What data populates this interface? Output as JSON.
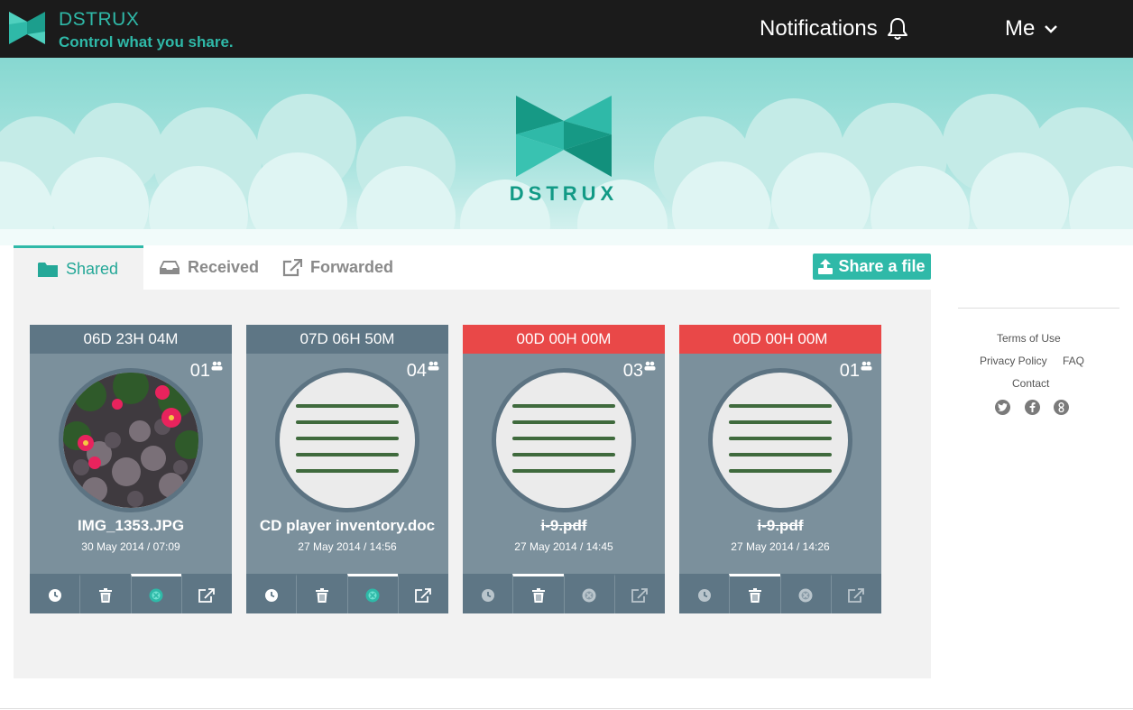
{
  "header": {
    "brand_name": "DSTRUX",
    "tagline": "Control what you share.",
    "notifications_label": "Notifications",
    "me_label": "Me"
  },
  "hero": {
    "wordmark": "DSTRUX"
  },
  "tabs": [
    {
      "label": "Shared",
      "icon": "folder-icon",
      "active": true
    },
    {
      "label": "Received",
      "icon": "inbox-icon"
    },
    {
      "label": "Forwarded",
      "icon": "external-link-icon"
    }
  ],
  "share_button": {
    "label": "Share a file",
    "icon": "upload-icon"
  },
  "cards": [
    {
      "timer": "06D 23H 04M",
      "count": "01",
      "name": "IMG_1353.JPG",
      "date": "30 May 2014 / 07:09",
      "thumbnail": "photo-flowers",
      "expired": false,
      "active_action": 2
    },
    {
      "timer": "07D 06H 50M",
      "count": "04",
      "name": "CD player inventory.doc",
      "date": "27 May 2014 / 14:56",
      "thumbnail": "document",
      "expired": false,
      "active_action": 2
    },
    {
      "timer": "00D 00H 00M",
      "count": "03",
      "name": "i-9.pdf",
      "date": "27 May 2014 / 14:45",
      "thumbnail": "document",
      "expired": true,
      "active_action": 1
    },
    {
      "timer": "00D 00H 00M",
      "count": "01",
      "name": "i-9.pdf",
      "date": "27 May 2014 / 14:26",
      "thumbnail": "document",
      "expired": true,
      "active_action": 1
    }
  ],
  "card_action_icons": [
    "clock-icon",
    "trash-icon",
    "stop-icon",
    "share-icon"
  ],
  "sidebar": {
    "terms": "Terms of Use",
    "privacy": "Privacy Policy",
    "faq": "FAQ",
    "contact": "Contact",
    "social": [
      "twitter-icon",
      "facebook-icon",
      "google-icon"
    ]
  },
  "colors": {
    "accent": "#2fb9a8",
    "expired": "#e94848",
    "card": "#7b909c",
    "card_dark": "#5e7685",
    "topbar": "#1b1b1b"
  }
}
